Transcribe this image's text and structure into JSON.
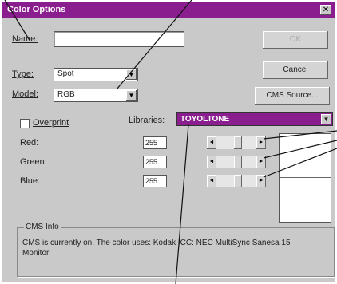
{
  "window": {
    "title": "Color Options",
    "close": "✕"
  },
  "name": {
    "label": "Name:",
    "value": ""
  },
  "type": {
    "label": "Type:",
    "value": "Spot"
  },
  "model": {
    "label": "Model:",
    "value": "RGB"
  },
  "overprint": {
    "label": "Overprint",
    "checked": false
  },
  "libraries": {
    "label": "Libraries:",
    "value": "TOYOLTONE"
  },
  "buttons": {
    "ok": "OK",
    "cancel": "Cancel",
    "cms_source": "CMS Source..."
  },
  "channels": [
    {
      "label": "Red:",
      "value": "255",
      "level": 0.55
    },
    {
      "label": "Green:",
      "value": "255",
      "level": 0.55
    },
    {
      "label": "Blue:",
      "value": "255",
      "level": 0.55
    }
  ],
  "cms_info": {
    "legend": "CMS Info",
    "text": "CMS is currently on. The color uses: Kodak ICC: NEC MultiSync Sanesa 15 Monitor"
  },
  "icons": [
    "close-icon",
    "dropdown-arrow-icon",
    "slider-left-arrow-icon",
    "slider-right-arrow-icon"
  ],
  "colors": {
    "titlebar": "#8a1e8f",
    "dialog": "#c9c9c9",
    "library_highlight": "#8a1e8f"
  }
}
